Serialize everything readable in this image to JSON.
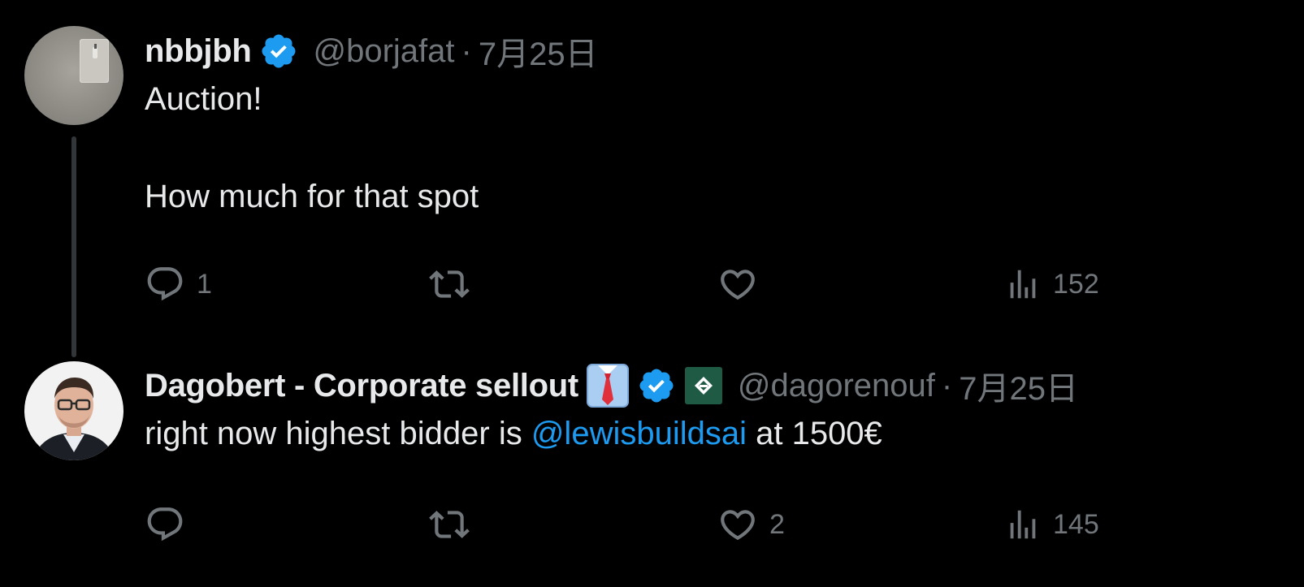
{
  "tweets": [
    {
      "name": "nbbjbh",
      "handle": "@borjafat",
      "separator": "·",
      "date": "7月25日",
      "text_lines": [
        "Auction!",
        "",
        "How much for that spot"
      ],
      "replies": "1",
      "retweets": "",
      "likes": "",
      "views": "152",
      "verified": true,
      "avatar": "photo-light-switch"
    },
    {
      "name": "Dagobert - Corporate sellout",
      "handle": "@dagorenouf",
      "separator": "·",
      "date": "7月25日",
      "text_before": "right now highest bidder is ",
      "mention": "@lewisbuildsai",
      "text_after": " at 1500€",
      "replies": "",
      "retweets": "",
      "likes": "2",
      "views": "145",
      "verified": true,
      "emoji": "shirt-tie-emoji",
      "affiliate_badge": "affiliate-logo",
      "avatar": "photo-man-glasses"
    }
  ],
  "colors": {
    "background": "#000000",
    "text": "#e7e9ea",
    "muted": "#71767b",
    "link": "#1d9bf0",
    "verified": "#1d9bf0",
    "thread_line": "#333639"
  },
  "icons": [
    "reply-icon",
    "retweet-icon",
    "like-icon",
    "views-icon",
    "verified-badge-icon"
  ]
}
